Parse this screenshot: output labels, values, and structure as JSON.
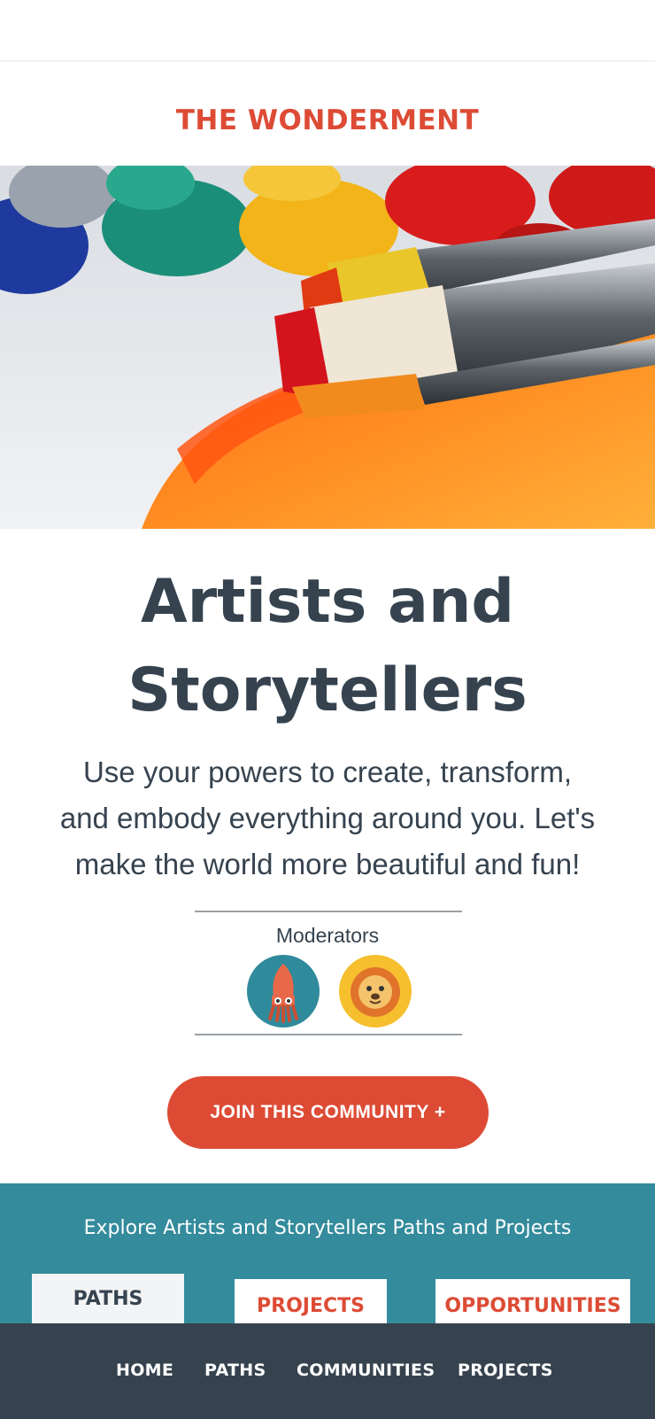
{
  "brand": {
    "title": "THE WONDERMENT",
    "color": "#dd4b35"
  },
  "hero": {
    "image": "paintbrushes-and-paint"
  },
  "community": {
    "title_line1": "Artists and",
    "title_line2": "Storytellers",
    "description_line1": "Use your powers to create, transform,",
    "description_line2": "and embody everything around you. Let's",
    "description_line3": "make the world more beautiful and fun!"
  },
  "moderators": {
    "label": "Moderators",
    "avatars": [
      {
        "icon": "squid-icon",
        "bg": "#2f8a9b"
      },
      {
        "icon": "lion-icon",
        "bg": "#f6bf2e"
      }
    ]
  },
  "join_button": {
    "label": "JOIN THIS COMMUNITY +"
  },
  "explore": {
    "text": "Explore Artists and Storytellers Paths and Projects",
    "tabs": [
      "PATHS",
      "PROJECTS",
      "OPPORTUNITIES"
    ]
  },
  "bottom_nav": [
    "HOME",
    "PATHS",
    "COMMUNITIES",
    "PROJECTS"
  ],
  "colors": {
    "accent": "#dd4b35",
    "teal": "#338b9c",
    "dark": "#36434f"
  }
}
